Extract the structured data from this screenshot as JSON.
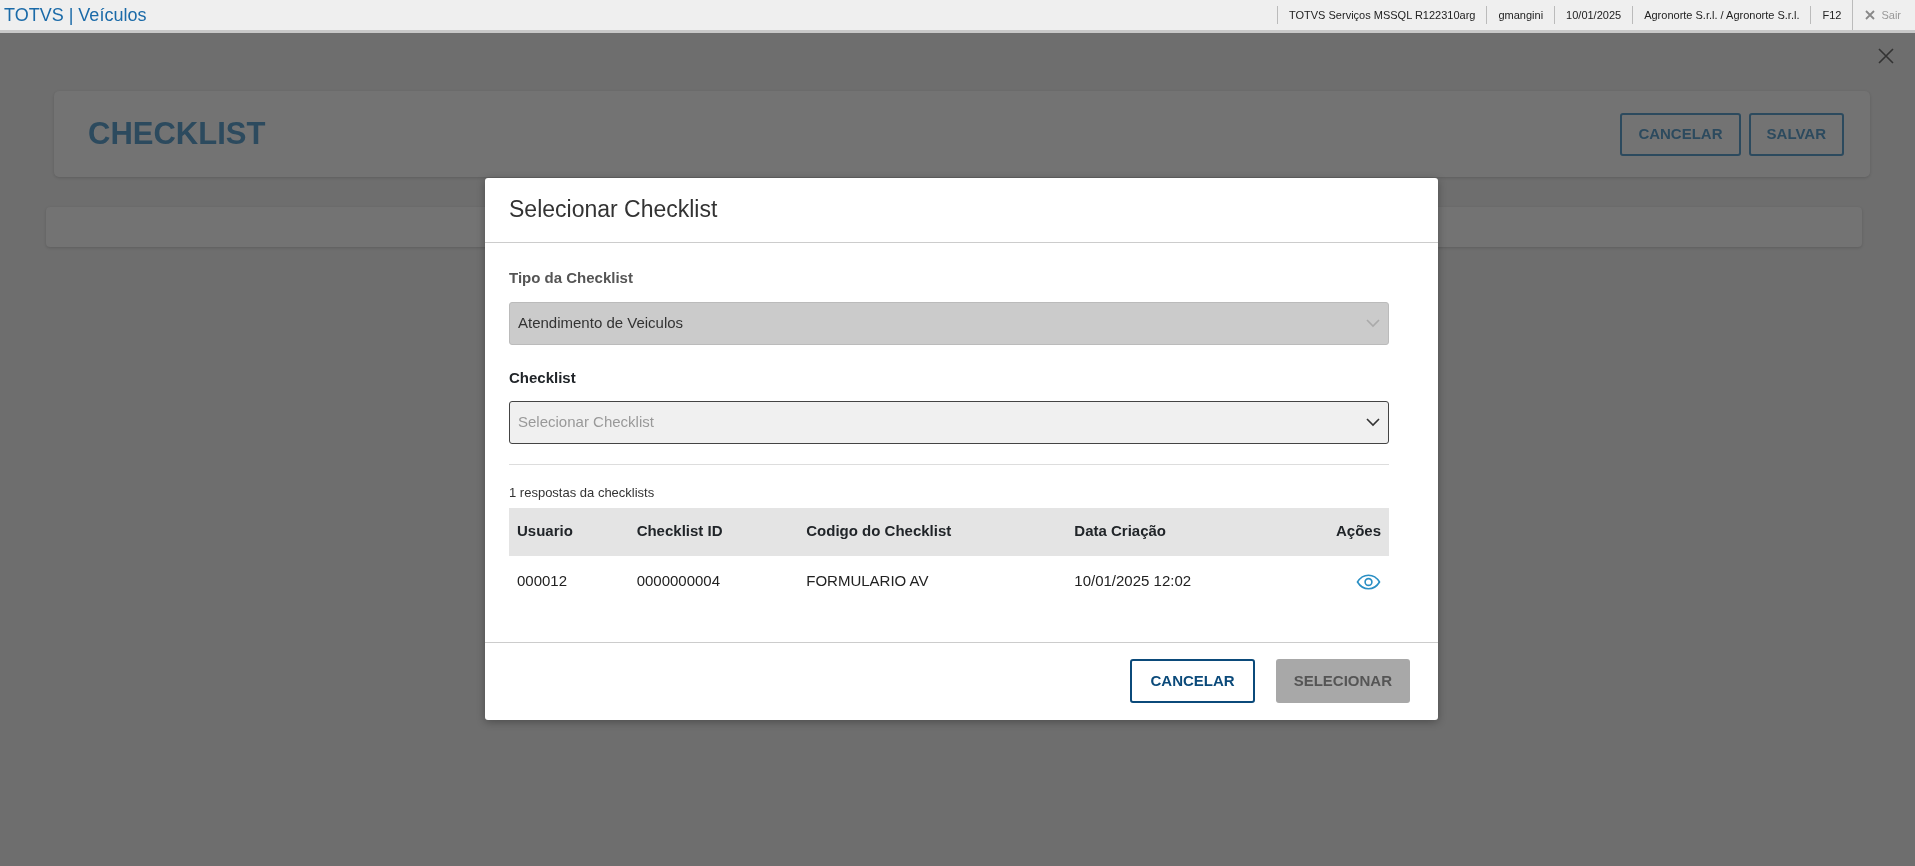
{
  "top_bar": {
    "app_title": "TOTVS | Veículos",
    "info": [
      "TOTVS Serviços MSSQL R122310arg",
      "gmangini",
      "10/01/2025",
      "Agronorte S.r.l. / Agronorte S.r.l.",
      "F12"
    ],
    "exit": {
      "label": "Sair",
      "disabled": true
    }
  },
  "page": {
    "title": "CHECKLIST",
    "buttons": [
      "CANCELAR",
      "SALVAR"
    ]
  },
  "modal": {
    "title": "Selecionar Checklist",
    "fields": [
      {
        "label": "Tipo da Checklist",
        "value": "Atendimento de Veiculos",
        "disabled": true
      },
      {
        "label": "Checklist",
        "placeholder": "Selecionar Checklist",
        "disabled": false
      }
    ],
    "results_caption": "1 respostas da checklists",
    "table": {
      "columns": [
        "Usuario",
        "Checklist ID",
        "Codigo do Checklist",
        "Data Criação",
        "Ações"
      ],
      "rows": [
        {
          "cells": [
            "000012",
            "0000000004",
            "FORMULARIO AV",
            "10/01/2025 12:02"
          ]
        }
      ]
    },
    "buttons": [
      {
        "label": "CANCELAR",
        "disabled": false
      },
      {
        "label": "SELECIONAR",
        "disabled": true
      }
    ]
  }
}
